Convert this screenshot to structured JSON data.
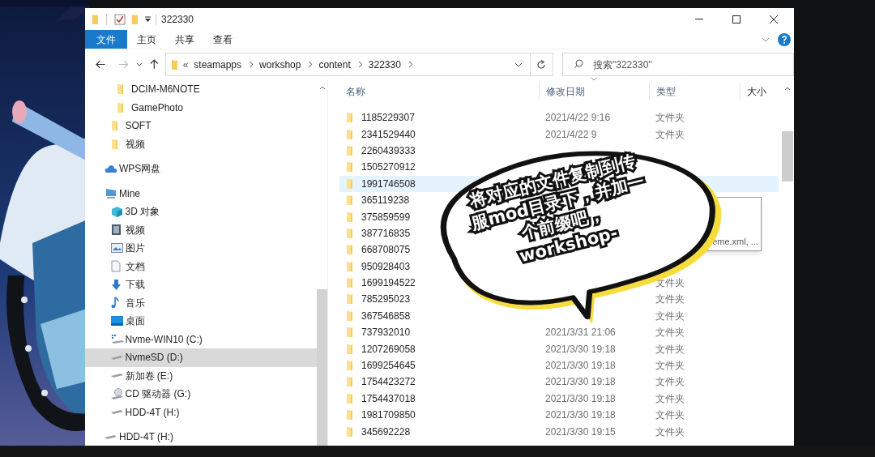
{
  "window": {
    "title": "322330"
  },
  "ribbon": {
    "tabs": [
      {
        "label": "文件",
        "selected": true
      },
      {
        "label": "主页",
        "selected": false
      },
      {
        "label": "共享",
        "selected": false
      },
      {
        "label": "查看",
        "selected": false
      }
    ]
  },
  "address": {
    "overflow": "«",
    "crumbs": [
      "steamapps",
      "workshop",
      "content",
      "322330"
    ]
  },
  "search": {
    "placeholder": "搜索\"322330\""
  },
  "nav": {
    "items": [
      {
        "children": [
          {
            "children": [
              {
                "label": "DCIM-M6NOTE",
                "kind": "folder",
                "selected": false
              },
              {
                "label": "GamePhoto",
                "kind": "folder",
                "selected": false
              }
            ]
          },
          {
            "label": "SOFT",
            "kind": "folder",
            "selected": false
          },
          {
            "label": "视频",
            "kind": "folder",
            "selected": false
          }
        ]
      },
      {
        "label": "WPS网盘",
        "kind": "cloud",
        "selected": false
      },
      {
        "label": "Mine",
        "kind": "pc",
        "selected": false,
        "children": [
          {
            "label": "3D 对象",
            "kind": "cube",
            "selected": false
          },
          {
            "label": "视频",
            "kind": "video",
            "selected": false
          },
          {
            "label": "图片",
            "kind": "pictures",
            "selected": false
          },
          {
            "label": "文档",
            "kind": "document",
            "selected": false
          },
          {
            "label": "下载",
            "kind": "download",
            "selected": false
          },
          {
            "label": "音乐",
            "kind": "music",
            "selected": false
          },
          {
            "label": "桌面",
            "kind": "desktop",
            "selected": false
          },
          {
            "label": "Nvme-WIN10 (C:)",
            "kind": "system-drive",
            "selected": false
          },
          {
            "label": "NvmeSD (D:)",
            "kind": "drive",
            "selected": true
          },
          {
            "label": "新加卷 (E:)",
            "kind": "drive",
            "selected": false
          },
          {
            "label": "CD 驱动器 (G:)",
            "kind": "cd",
            "selected": false
          },
          {
            "label": "HDD-4T (H:)",
            "kind": "drive",
            "selected": false
          }
        ]
      },
      {
        "label": "HDD-4T (H:)",
        "kind": "drive",
        "selected": false
      }
    ]
  },
  "files": {
    "columns": [
      "名称",
      "修改日期",
      "类型",
      "大小"
    ],
    "rows": [
      {
        "name": "1185229307",
        "date": "2021/4/22 9:16",
        "type": "文件夹",
        "selected": false
      },
      {
        "name": "2341529440",
        "date": "2021/4/22 9",
        "type": "文件夹",
        "selected": false
      },
      {
        "name": "2260439333",
        "selected": false
      },
      {
        "name": "1505270912",
        "selected": false
      },
      {
        "name": "1991746508",
        "selected": true
      },
      {
        "name": "365119238",
        "selected": false
      },
      {
        "name": "375859599",
        "selected": false
      },
      {
        "name": "387716835",
        "selected": false
      },
      {
        "name": "668708075",
        "selected": false
      },
      {
        "name": "950928403",
        "selected": false
      },
      {
        "name": "1699194522",
        "type": "文件夹",
        "selected": false
      },
      {
        "name": "785295023",
        "type": "文件夹",
        "selected": false
      },
      {
        "name": "367546858",
        "type": "文件夹",
        "selected": false
      },
      {
        "name": "737932010",
        "date": "2021/3/31 21:06",
        "type": "文件夹",
        "selected": false
      },
      {
        "name": "1207269058",
        "date": "2021/3/30 19:18",
        "type": "文件夹",
        "selected": false
      },
      {
        "name": "1699254645",
        "date": "2021/3/30 19:18",
        "type": "文件夹",
        "selected": false
      },
      {
        "name": "1754423272",
        "date": "2021/3/30 19:18",
        "type": "文件夹",
        "selected": false
      },
      {
        "name": "1754437018",
        "date": "2021/3/30 19:18",
        "type": "文件夹",
        "selected": false
      },
      {
        "name": "1981709850",
        "date": "2021/3/30 19:18",
        "type": "文件夹",
        "selected": false
      },
      {
        "name": "345692228",
        "date": "2021/3/30 19:15",
        "type": "文件夹",
        "selected": false
      }
    ]
  },
  "tooltip": {
    "text": "eme.xml, ..."
  },
  "bubble": {
    "lines": [
      "将对应的文件复制到传",
      "服mod目录下，并加一",
      "个前缀吧，",
      "workshop-"
    ]
  }
}
